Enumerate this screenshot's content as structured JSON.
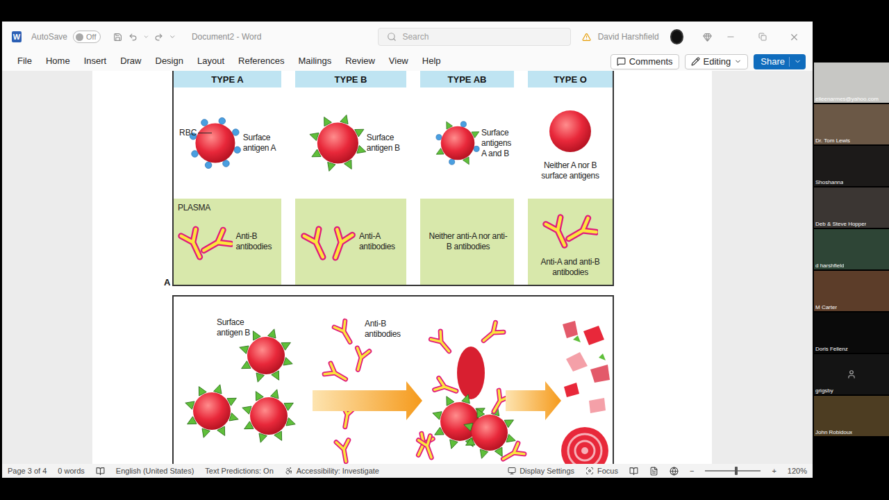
{
  "window": {
    "title": "Document2 - Word",
    "app_logo": "W"
  },
  "titlebar": {
    "autosave_label": "AutoSave",
    "autosave_on": false,
    "autosave_state": "Off",
    "search_placeholder": "Search",
    "user": "David Harshfield"
  },
  "ribbon_tabs": [
    {
      "label": "File",
      "selected": false
    },
    {
      "label": "Home",
      "selected": false
    },
    {
      "label": "Insert",
      "selected": false
    },
    {
      "label": "Draw",
      "selected": false
    },
    {
      "label": "Design",
      "selected": false
    },
    {
      "label": "Layout",
      "selected": false
    },
    {
      "label": "References",
      "selected": false
    },
    {
      "label": "Mailings",
      "selected": false
    },
    {
      "label": "Review",
      "selected": false
    },
    {
      "label": "View",
      "selected": false
    },
    {
      "label": "Help",
      "selected": false
    }
  ],
  "ribbon_actions": {
    "comments": "Comments",
    "editing": "Editing",
    "share": "Share"
  },
  "figure": {
    "panel_label": "A",
    "plasma_label": "PLASMA",
    "types": [
      {
        "header": "TYPE A",
        "pointer_label": "RBC",
        "antigens": [
          "A"
        ],
        "cell_label": "Surface antigen A",
        "antibodies": [
          "anti-B"
        ],
        "plasma_text": "Anti-B antibodies"
      },
      {
        "header": "TYPE B",
        "antigens": [
          "B"
        ],
        "cell_label": "Surface antigen B",
        "antibodies": [
          "anti-A"
        ],
        "plasma_text": "Anti-A antibodies"
      },
      {
        "header": "TYPE AB",
        "antigens": [
          "A",
          "B"
        ],
        "cell_label": "Surface antigens A and B",
        "antibodies": [],
        "plasma_text": "Neither anti-A nor anti-B antibodies"
      },
      {
        "header": "TYPE O",
        "antigens": [],
        "cell_label": "Neither A nor B surface antigens",
        "antibodies": [
          "anti-A",
          "anti-B"
        ],
        "plasma_text": "Anti-A and anti-B antibodies"
      }
    ],
    "reaction": {
      "cells_label": "Surface antigen B",
      "antibodies_label": "Anti-B antibodies"
    }
  },
  "status_bar": {
    "page": "Page 3 of 4",
    "words": "0 words",
    "language": "English (United States)",
    "predictions": "Text Predictions: On",
    "accessibility": "Accessibility: Investigate",
    "display_settings": "Display Settings",
    "focus": "Focus",
    "zoom_minus": "−",
    "zoom_plus": "+",
    "zoom_label": "120%",
    "zoom_level": 0.56
  },
  "participants": [
    {
      "name": "eileenarmes@yahoo.com",
      "kind": "video",
      "color": "#c7c7c4"
    },
    {
      "name": "Dr. Tom Lewis",
      "kind": "video",
      "color": "#6b5846"
    },
    {
      "name": "Shoshanna",
      "kind": "video",
      "color": "#1c1a19"
    },
    {
      "name": "Deb & Steve Hopper",
      "kind": "video",
      "color": "#3b3633"
    },
    {
      "name": "d harshfield",
      "kind": "video",
      "color": "#2e4536"
    },
    {
      "name": "M Carter",
      "kind": "video",
      "color": "#5c3d29"
    },
    {
      "name": "Doris Fellenz",
      "kind": "name",
      "color": "#0a0a0a"
    },
    {
      "name": "grigsby",
      "kind": "avatar",
      "color": "#141414"
    },
    {
      "name": "John Robidoux",
      "kind": "video",
      "color": "#4d3d22"
    }
  ]
}
